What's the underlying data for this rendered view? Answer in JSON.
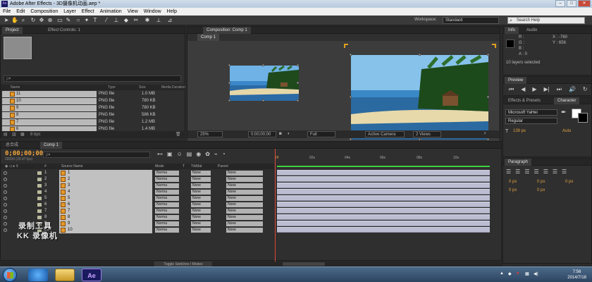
{
  "window": {
    "title": "Adobe After Effects - 3D摄像机动画.aep *",
    "app_icon": "Ae"
  },
  "menu": [
    "File",
    "Edit",
    "Composition",
    "Layer",
    "Effect",
    "Animation",
    "View",
    "Window",
    "Help"
  ],
  "workspace": {
    "label": "Workspace:",
    "value": "Standard"
  },
  "search_help": {
    "placeholder": "Search Help"
  },
  "project_panel": {
    "tabs": [
      "Project",
      "Effect Controls: 1"
    ],
    "search_placeholder": "ρ▾",
    "columns": [
      "Name",
      "Type",
      "Size",
      "Media Duration"
    ],
    "items": [
      {
        "name": "11",
        "type": "PNG file",
        "size": "1.0 MB"
      },
      {
        "name": "10",
        "type": "PNG file",
        "size": "780 KB"
      },
      {
        "name": "9",
        "type": "PNG file",
        "size": "780 KB"
      },
      {
        "name": "8",
        "type": "PNG file",
        "size": "586 KB"
      },
      {
        "name": "7",
        "type": "PNG file",
        "size": "1.2 MB"
      },
      {
        "name": "6",
        "type": "PNG file",
        "size": "1.4 MB"
      }
    ],
    "footer_bpc": "8 bpc"
  },
  "composition_panel": {
    "tab": "Composition: Comp 1",
    "subtab": "Comp 1",
    "zoom": "25%",
    "timecode": "0;00;00;00",
    "resolution": "Full",
    "camera": "Active Camera",
    "views": "2 Views"
  },
  "info_panel": {
    "tabs": [
      "Info",
      "Audio"
    ],
    "rgba": [
      "R :",
      "G :",
      "B :",
      "A : 0"
    ],
    "coords": [
      "X : -760",
      "Y : 656"
    ],
    "status": "10 layers selected"
  },
  "preview_panel": {
    "tab": "Preview"
  },
  "effects_panel": {
    "tabs": [
      "Effects & Presets",
      "Character"
    ]
  },
  "character_panel": {
    "font": "Microsoft YaHei",
    "style": "Regular",
    "size": "139 px",
    "leading": "Auto"
  },
  "paragraph_panel": {
    "tab": "Paragraph",
    "values": [
      "0 px",
      "0 px",
      "0 px",
      "0 px",
      "0 px"
    ]
  },
  "timeline": {
    "tabs": [
      "总合成",
      "Comp 1"
    ],
    "time": "0;00;00;00",
    "fps": "00000 (29.97 fps)",
    "search_placeholder": "ρ▾",
    "columns": [
      "#",
      "Source Name",
      "Mode",
      "T",
      "TrkMat",
      "Parent"
    ],
    "ruler": [
      "0f",
      "02s",
      "04s",
      "06s",
      "08s",
      "10s"
    ],
    "mode_value": "Norma",
    "trkmat_value": "None",
    "parent_value": "None",
    "layers": [
      "1",
      "2",
      "3",
      "4",
      "5",
      "6",
      "7",
      "8",
      "9",
      "10"
    ],
    "toggle_label": "Toggle Switches / Modes"
  },
  "watermark": {
    "line1": "录制工具",
    "line2": "KK 录像机"
  },
  "taskbar": {
    "app_label": "Ae",
    "time": "7:56",
    "date": "2014/7/18"
  }
}
